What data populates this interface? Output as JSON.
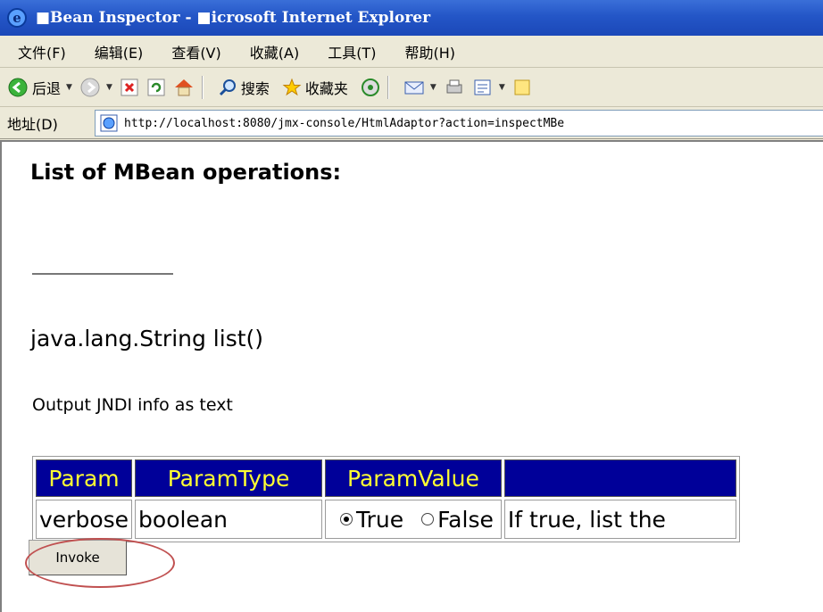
{
  "window": {
    "title": "■Bean Inspector - ■icrosoft Internet Explorer"
  },
  "menu": [
    "文件(F)",
    "编辑(E)",
    "查看(V)",
    "收藏(A)",
    "工具(T)",
    "帮助(H)"
  ],
  "toolbar": {
    "back_label": "后退",
    "search_label": "搜索",
    "favorites_label": "收藏夹"
  },
  "address": {
    "label": "地址(D)",
    "url": "http://localhost:8080/jmx-console/HtmlAdaptor?action=inspectMBe"
  },
  "page": {
    "heading": "List of MBean operations:",
    "operation_signature": "java.lang.String list()",
    "operation_description": "Output JNDI info as text",
    "table": {
      "headers": [
        "Param",
        "ParamType",
        "ParamValue",
        ""
      ],
      "row": {
        "param": "verbose",
        "type": "boolean",
        "true_label": "True",
        "false_label": "False",
        "description": "If true, list the"
      }
    },
    "invoke_label": "Invoke"
  },
  "colors": {
    "table_header_bg": "#000099",
    "table_header_text": "#ffff33",
    "annotation_circle": "#c05050"
  }
}
